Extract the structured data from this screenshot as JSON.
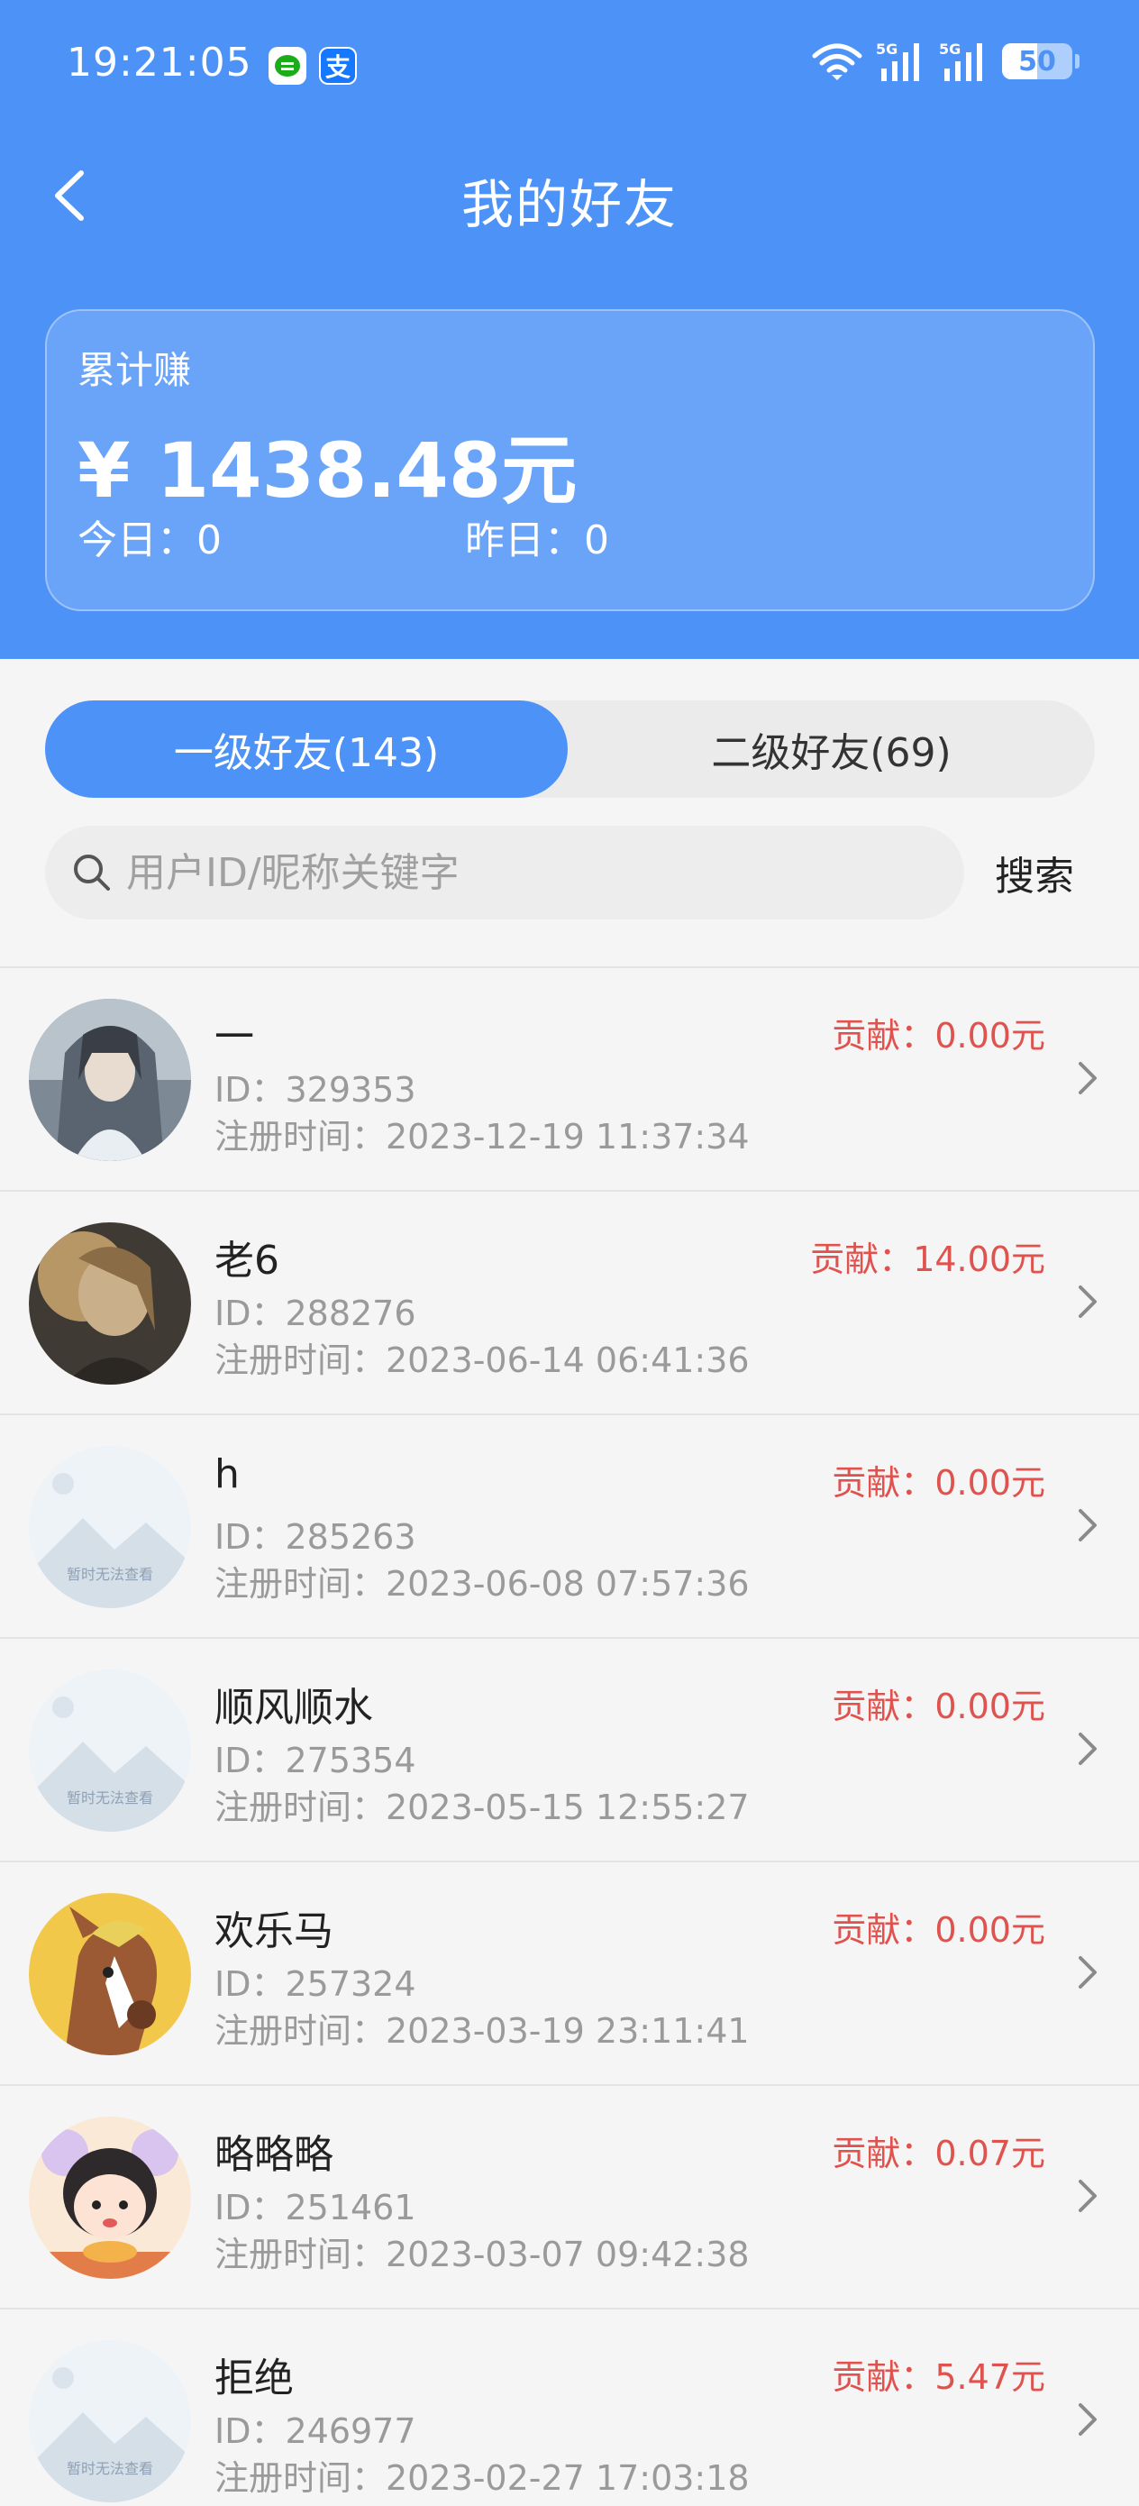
{
  "status_bar": {
    "time": "19:21:05",
    "network_label": "5G",
    "battery": "50",
    "icons": [
      "message-app-icon",
      "alipay-icon",
      "wifi-icon",
      "signal-5g-icon",
      "signal-5g-icon",
      "battery-icon"
    ]
  },
  "nav": {
    "title": "我的好友",
    "back_icon": "chevron-left-icon"
  },
  "earnings": {
    "label": "累计赚",
    "amount": "¥ 1438.48元",
    "today": "今日：0",
    "yesterday": "昨日：0"
  },
  "tabs": [
    {
      "label": "一级好友(143)",
      "active": true
    },
    {
      "label": "二级好友(69)",
      "active": false
    }
  ],
  "search": {
    "placeholder": "用户ID/昵称关键字",
    "value": "",
    "button_label": "搜索",
    "placeholder_img_text": "暂时无法查看"
  },
  "colors": {
    "primary": "#4d93f7",
    "contribution": "#e0524d",
    "muted": "#9a9a9a"
  },
  "friends": [
    {
      "nickname": "一",
      "id": "ID：329353",
      "register": "注册时间：2023-12-19 11:37:34",
      "contribution": "贡献：0.00元",
      "avatar": "photo-portrait-1"
    },
    {
      "nickname": "老6",
      "id": "ID：288276",
      "register": "注册时间：2023-06-14 06:41:36",
      "contribution": "贡献：14.00元",
      "avatar": "photo-portrait-2"
    },
    {
      "nickname": "h",
      "id": "ID：285263",
      "register": "注册时间：2023-06-08 07:57:36",
      "contribution": "贡献：0.00元",
      "avatar": "placeholder"
    },
    {
      "nickname": "顺风顺水",
      "id": "ID：275354",
      "register": "注册时间：2023-05-15 12:55:27",
      "contribution": "贡献：0.00元",
      "avatar": "placeholder"
    },
    {
      "nickname": "欢乐马",
      "id": "ID：257324",
      "register": "注册时间：2023-03-19 23:11:41",
      "contribution": "贡献：0.00元",
      "avatar": "cartoon-horse"
    },
    {
      "nickname": "略略略",
      "id": "ID：251461",
      "register": "注册时间：2023-03-07 09:42:38",
      "contribution": "贡献：0.07元",
      "avatar": "cartoon-girl"
    },
    {
      "nickname": "拒绝",
      "id": "ID：246977",
      "register": "注册时间：2023-02-27 17:03:18",
      "contribution": "贡献：5.47元",
      "avatar": "placeholder"
    }
  ]
}
